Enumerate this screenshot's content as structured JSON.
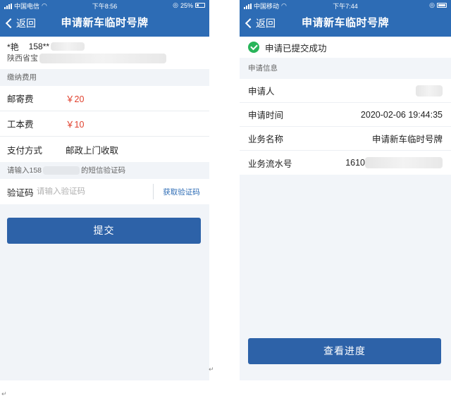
{
  "left": {
    "status": {
      "carrier": "中国电信",
      "time": "下午8:56",
      "battery": "25%"
    },
    "nav": {
      "back": "返回",
      "title": "申请新车临时号牌"
    },
    "address": {
      "name": "*艳",
      "phone": "158**",
      "region": "陕西省宝"
    },
    "fees_section": "缴纳费用",
    "fees": [
      {
        "label": "邮寄费",
        "value": "￥20"
      },
      {
        "label": "工本费",
        "value": "￥10"
      },
      {
        "label": "支付方式",
        "value": "邮政上门收取"
      }
    ],
    "sms_hint_prefix": "请输入158",
    "sms_hint_suffix": "的短信验证码",
    "code": {
      "label": "验证码",
      "placeholder": "请输入验证码",
      "get_code": "获取验证码"
    },
    "submit": "提交"
  },
  "right": {
    "status": {
      "carrier": "中国移动",
      "time": "下午7:44"
    },
    "nav": {
      "back": "返回",
      "title": "申请新车临时号牌"
    },
    "success": "申请已提交成功",
    "info_section": "申请信息",
    "info": [
      {
        "label": "申请人",
        "value": ""
      },
      {
        "label": "申请时间",
        "value": "2020-02-06 19:44:35"
      },
      {
        "label": "业务名称",
        "value": "申请新车临时号牌"
      },
      {
        "label": "业务流水号",
        "value": "1610"
      }
    ],
    "progress_button": "查看进度"
  },
  "colors": {
    "brand": "#2d6cb5",
    "button": "#2d62a8",
    "price": "#e0402d",
    "success": "#29b55a"
  }
}
